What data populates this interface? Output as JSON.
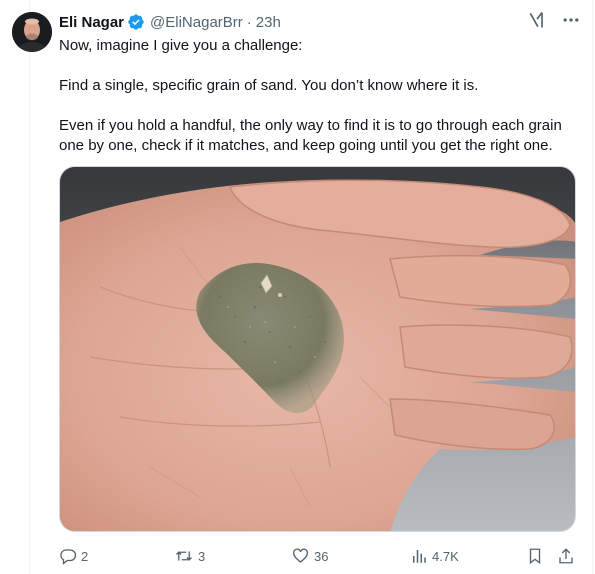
{
  "author": {
    "name": "Eli Nagar",
    "handle": "@EliNagarBrr",
    "separator": "·",
    "time": "23h",
    "verified_icon": "verified-badge-icon"
  },
  "tweet": {
    "lines": [
      "Now, imagine I give you a challenge:",
      "Find a single, specific grain of sand. You don’t know where it is.",
      "Even if you hold a handful, the only way to find it is to go through each grain one by one, check if it matches, and keep going until you get the right one."
    ]
  },
  "actions": {
    "replies": "2",
    "reposts": "3",
    "likes": "36",
    "views": "4.7K"
  },
  "colors": {
    "accent": "#1d9bf0",
    "muted": "#536471",
    "text": "#0f1419"
  },
  "icons": [
    "grok-icon",
    "more-icon",
    "reply-icon",
    "repost-icon",
    "like-icon",
    "views-icon",
    "bookmark-icon",
    "share-icon"
  ]
}
